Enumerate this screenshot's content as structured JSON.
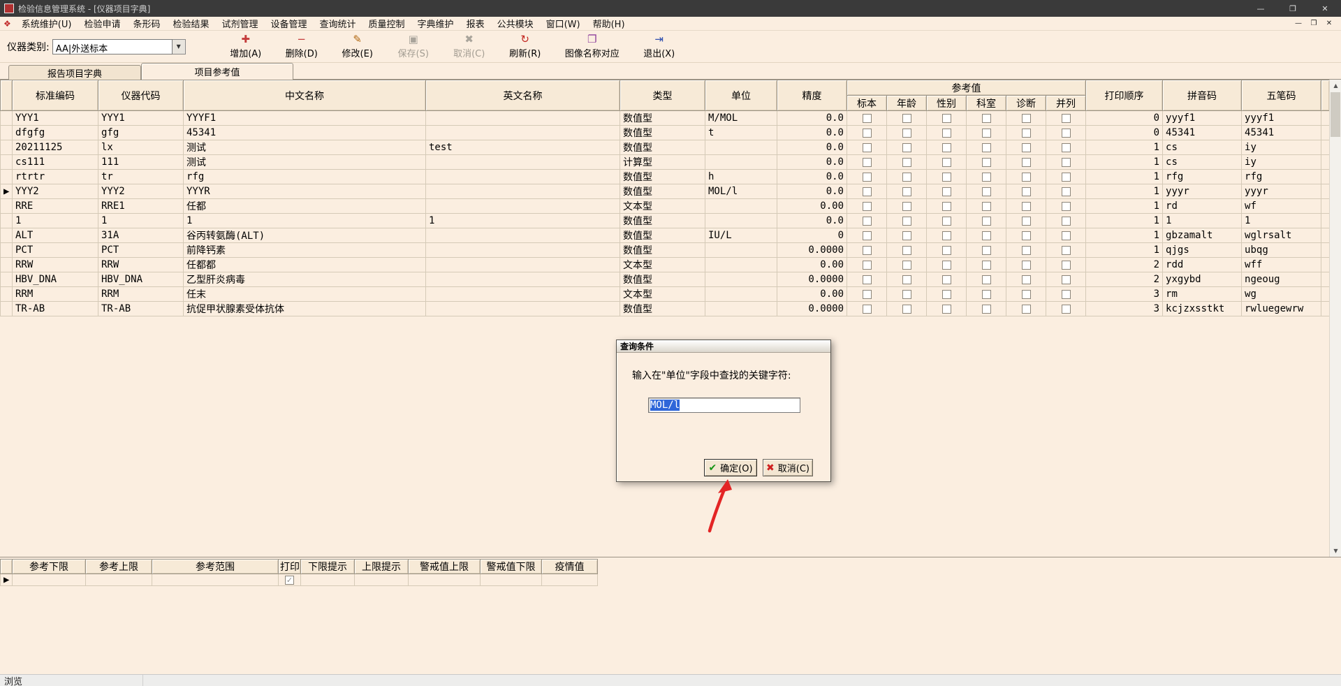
{
  "window": {
    "title": "检验信息管理系统 - [仪器项目字典]",
    "controls": {
      "minimize": "—",
      "maximize": "❐",
      "close": "✕"
    },
    "mdi_icon": "❖",
    "mdi_controls": {
      "minimize": "—",
      "restore": "❐",
      "close": "✕"
    },
    "status": "浏览"
  },
  "menu": {
    "items": [
      "系统维护(U)",
      "检验申请",
      "条形码",
      "检验结果",
      "试剂管理",
      "设备管理",
      "查询统计",
      "质量控制",
      "字典维护",
      "报表",
      "公共模块",
      "窗口(W)",
      "帮助(H)"
    ]
  },
  "toolbar": {
    "category_label": "仪器类别:",
    "category_value": "AA|外送标本",
    "combo_arrow": "▼",
    "buttons": [
      {
        "name": "add",
        "label": "增加(A)",
        "glyph": "✚",
        "color": "#c43b3b",
        "enabled": true
      },
      {
        "name": "delete",
        "label": "删除(D)",
        "glyph": "−",
        "color": "#c43b3b",
        "enabled": true
      },
      {
        "name": "edit",
        "label": "修改(E)",
        "glyph": "✎",
        "color": "#b0660f",
        "enabled": true
      },
      {
        "name": "save",
        "label": "保存(S)",
        "glyph": "▣",
        "color": "#a9a49b",
        "enabled": false
      },
      {
        "name": "cancel",
        "label": "取消(C)",
        "glyph": "✖",
        "color": "#a9a49b",
        "enabled": false
      },
      {
        "name": "refresh",
        "label": "刷新(R)",
        "glyph": "↻",
        "color": "#c2251f",
        "enabled": true
      },
      {
        "name": "image-map",
        "label": "图像名称对应",
        "glyph": "❐",
        "color": "#8d3f9c",
        "enabled": true
      },
      {
        "name": "exit",
        "label": "退出(X)",
        "glyph": "⇥",
        "color": "#2f4fae",
        "enabled": true
      }
    ]
  },
  "tabs": [
    {
      "label": "报告项目字典",
      "active": false
    },
    {
      "label": "项目参考值",
      "active": true
    }
  ],
  "main_table": {
    "columns_left": [
      "标准编码",
      "仪器代码",
      "中文名称",
      "英文名称",
      "类型",
      "单位",
      "精度"
    ],
    "ref_group": {
      "label": "参考值",
      "children": [
        "标本",
        "年龄",
        "性别",
        "科室",
        "诊断",
        "并列"
      ]
    },
    "columns_right": [
      "打印顺序",
      "拼音码",
      "五笔码"
    ],
    "ref_checkboxes_all_unchecked": true,
    "rows": [
      {
        "std": "YYY1",
        "inst": "YYY1",
        "cn": "YYYF1",
        "en": "",
        "type": "数值型",
        "unit": "M/MOL",
        "prec": "0.0",
        "order": "0",
        "py": "yyyf1",
        "wb": "yyyf1",
        "current": false
      },
      {
        "std": "dfgfg",
        "inst": "gfg",
        "cn": "45341",
        "en": "",
        "type": "数值型",
        "unit": "t",
        "prec": "0.0",
        "order": "0",
        "py": "45341",
        "wb": "45341",
        "current": false
      },
      {
        "std": "20211125",
        "inst": "lx",
        "cn": "测试",
        "en": "test",
        "type": "数值型",
        "unit": "",
        "prec": "0.0",
        "order": "1",
        "py": "cs",
        "wb": "iy",
        "current": false
      },
      {
        "std": "cs111",
        "inst": "111",
        "cn": "测试",
        "en": "",
        "type": "计算型",
        "unit": "",
        "prec": "0.0",
        "order": "1",
        "py": "cs",
        "wb": "iy",
        "current": false
      },
      {
        "std": "rtrtr",
        "inst": "tr",
        "cn": "rfg",
        "en": "",
        "type": "数值型",
        "unit": "h",
        "prec": "0.0",
        "order": "1",
        "py": "rfg",
        "wb": "rfg",
        "current": false
      },
      {
        "std": "YYY2",
        "inst": "YYY2",
        "cn": "YYYR",
        "en": "",
        "type": "数值型",
        "unit": "MOL/l",
        "prec": "0.0",
        "order": "1",
        "py": "yyyr",
        "wb": "yyyr",
        "current": true
      },
      {
        "std": "RRE",
        "inst": "RRE1",
        "cn": "任都",
        "en": "",
        "type": "文本型",
        "unit": "",
        "prec": "0.00",
        "order": "1",
        "py": "rd",
        "wb": "wf",
        "current": false
      },
      {
        "std": "1",
        "inst": "1",
        "cn": "1",
        "en": "1",
        "type": "数值型",
        "unit": "",
        "prec": "0.0",
        "order": "1",
        "py": "1",
        "wb": "1",
        "current": false
      },
      {
        "std": "ALT",
        "inst": "31A",
        "cn": "谷丙转氨酶(ALT)",
        "en": "",
        "type": "数值型",
        "unit": "IU/L",
        "prec": "0",
        "order": "1",
        "py": "gbzamalt",
        "wb": "wglrsalt",
        "current": false
      },
      {
        "std": "PCT",
        "inst": "PCT",
        "cn": "前降钙素",
        "en": "",
        "type": "数值型",
        "unit": "",
        "prec": "0.0000",
        "order": "1",
        "py": "qjgs",
        "wb": "ubqg",
        "current": false
      },
      {
        "std": "RRW",
        "inst": "RRW",
        "cn": "任都都",
        "en": "",
        "type": "文本型",
        "unit": "",
        "prec": "0.00",
        "order": "2",
        "py": "rdd",
        "wb": "wff",
        "current": false
      },
      {
        "std": "HBV_DNA",
        "inst": "HBV_DNA",
        "cn": "乙型肝炎病毒",
        "en": "",
        "type": "数值型",
        "unit": "",
        "prec": "0.0000",
        "order": "2",
        "py": "yxgybd",
        "wb": "ngeoug",
        "current": false
      },
      {
        "std": "RRM",
        "inst": "RRM",
        "cn": "任末",
        "en": "",
        "type": "文本型",
        "unit": "",
        "prec": "0.00",
        "order": "3",
        "py": "rm",
        "wb": "wg",
        "current": false
      },
      {
        "std": "TR-AB",
        "inst": "TR-AB",
        "cn": "抗促甲状腺素受体抗体",
        "en": "",
        "type": "数值型",
        "unit": "",
        "prec": "0.0000",
        "order": "3",
        "py": "kcjzxsstkt",
        "wb": "rwluegewrw",
        "current": false
      }
    ]
  },
  "dialog": {
    "title": "查询条件",
    "prompt": "输入在\"单位\"字段中查找的关键字符:",
    "input_value": "MOL/l",
    "ok_icon": "✔",
    "ok_label": "确定(O)",
    "cancel_icon": "✖",
    "cancel_label": "取消(C)"
  },
  "bottom_table": {
    "headers": [
      "参考下限",
      "参考上限",
      "参考范围",
      "打印",
      "下限提示",
      "上限提示",
      "警戒值上限",
      "警戒值下限",
      "疫情值"
    ],
    "row": {
      "print_checked": true
    }
  },
  "scrollbar": {
    "up": "▲",
    "down": "▼"
  }
}
